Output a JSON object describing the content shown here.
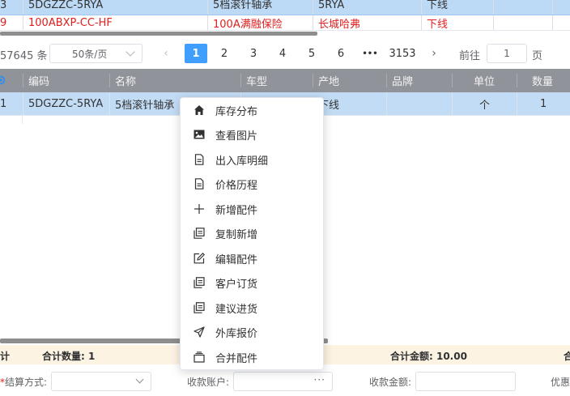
{
  "top_table": {
    "row1": {
      "idx": "3",
      "code": "5DGZZC-5RYA",
      "name": "5档滚针轴承",
      "model": "5RYA",
      "origin": "下线"
    },
    "row2": {
      "idx": "9",
      "code": "100ABXP-CC-HF",
      "name": "100A满融保险",
      "model": "长城哈弗",
      "origin": "下线"
    }
  },
  "pager": {
    "total": "57645 条",
    "page_size": "50条/页",
    "prev": "‹",
    "next": "›",
    "pages": [
      "1",
      "2",
      "3",
      "4",
      "5",
      "6",
      "•••",
      "3153"
    ],
    "goto_label": "前往",
    "goto_value": "1",
    "page_unit": "页"
  },
  "lower_table": {
    "headers": [
      "编码",
      "名称",
      "车型",
      "产地",
      "品牌",
      "单位",
      "数量"
    ],
    "row": {
      "idx": "1",
      "code": "5DGZZC-5RYA",
      "name": "5档滚针轴承",
      "origin": "下线",
      "unit": "个",
      "qty": "1"
    }
  },
  "context_menu": {
    "items": [
      {
        "label": "库存分布",
        "icon": "home-icon"
      },
      {
        "label": "查看图片",
        "icon": "image-icon"
      },
      {
        "label": "出入库明细",
        "icon": "document-icon"
      },
      {
        "label": "价格历程",
        "icon": "document-icon"
      },
      {
        "label": "新增配件",
        "icon": "plus-icon"
      },
      {
        "label": "复制新增",
        "icon": "copy-icon"
      },
      {
        "label": "编辑配件",
        "icon": "edit-icon"
      },
      {
        "label": "客户订货",
        "icon": "copy-icon"
      },
      {
        "label": "建议进货",
        "icon": "copy-icon"
      },
      {
        "label": "外库报价",
        "icon": "send-icon"
      },
      {
        "label": "合并配件",
        "icon": "merge-icon"
      }
    ]
  },
  "summary": {
    "left_fragment": "计",
    "total_qty": "合计数量:  1",
    "total_amount": "合计金额:  10.00",
    "right_fragment": "合"
  },
  "form": {
    "settle_method": "*结算方式:",
    "settle_required": "*",
    "settle_label": "结算方式:",
    "receive_account": "收款账户:",
    "receive_amount": "收款金额:",
    "discount_fragment": "优惠"
  },
  "colors": {
    "selected_row": "#c3dcf5",
    "header_bg": "#909399",
    "active_page": "#409eff",
    "summary_bg": "#fdf3e3",
    "red_text": "#e02020"
  }
}
